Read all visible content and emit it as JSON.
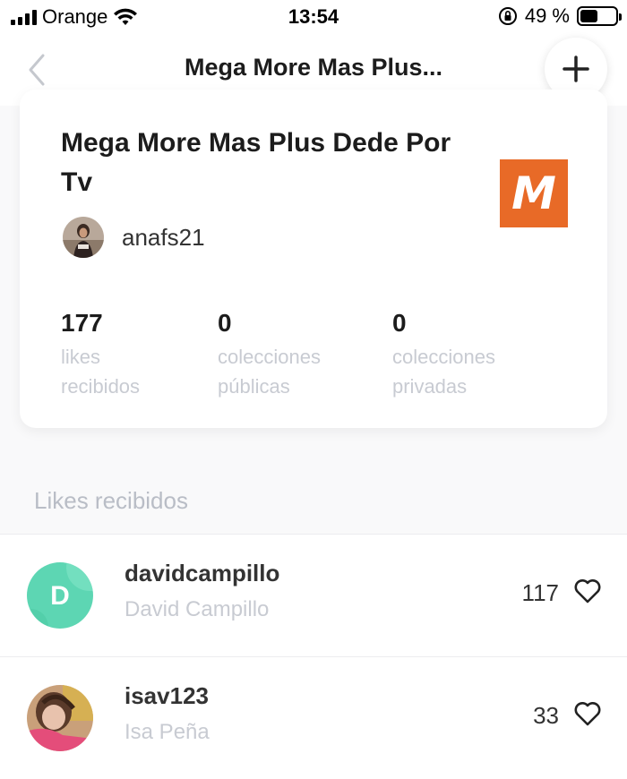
{
  "status_bar": {
    "carrier": "Orange",
    "time": "13:54",
    "battery_percent": "49 %",
    "battery_level": 0.49
  },
  "nav": {
    "title": "Mega More Mas Plus...",
    "back_icon": "chevron-left-icon",
    "add_icon": "plus-icon"
  },
  "collection": {
    "title": "Mega More Mas Plus Dede Por Tv",
    "logo_letter": "M",
    "logo_color": "#e86a27",
    "owner": "anafs21",
    "stats": [
      {
        "value": "177",
        "label_line1": "likes",
        "label_line2": "recibidos"
      },
      {
        "value": "0",
        "label_line1": "colecciones",
        "label_line2": "públicas"
      },
      {
        "value": "0",
        "label_line1": "colecciones",
        "label_line2": "privadas"
      }
    ]
  },
  "likes_section": {
    "title": "Likes recibidos",
    "rows": [
      {
        "username": "davidcampillo",
        "display_name": "David Campillo",
        "count": "117",
        "avatar_letter": "D",
        "avatar_color": "#5dd6b3"
      },
      {
        "username": "isav123",
        "display_name": "Isa Peña",
        "count": "33",
        "avatar_letter": "",
        "avatar_color": "#c9a07a"
      }
    ]
  }
}
